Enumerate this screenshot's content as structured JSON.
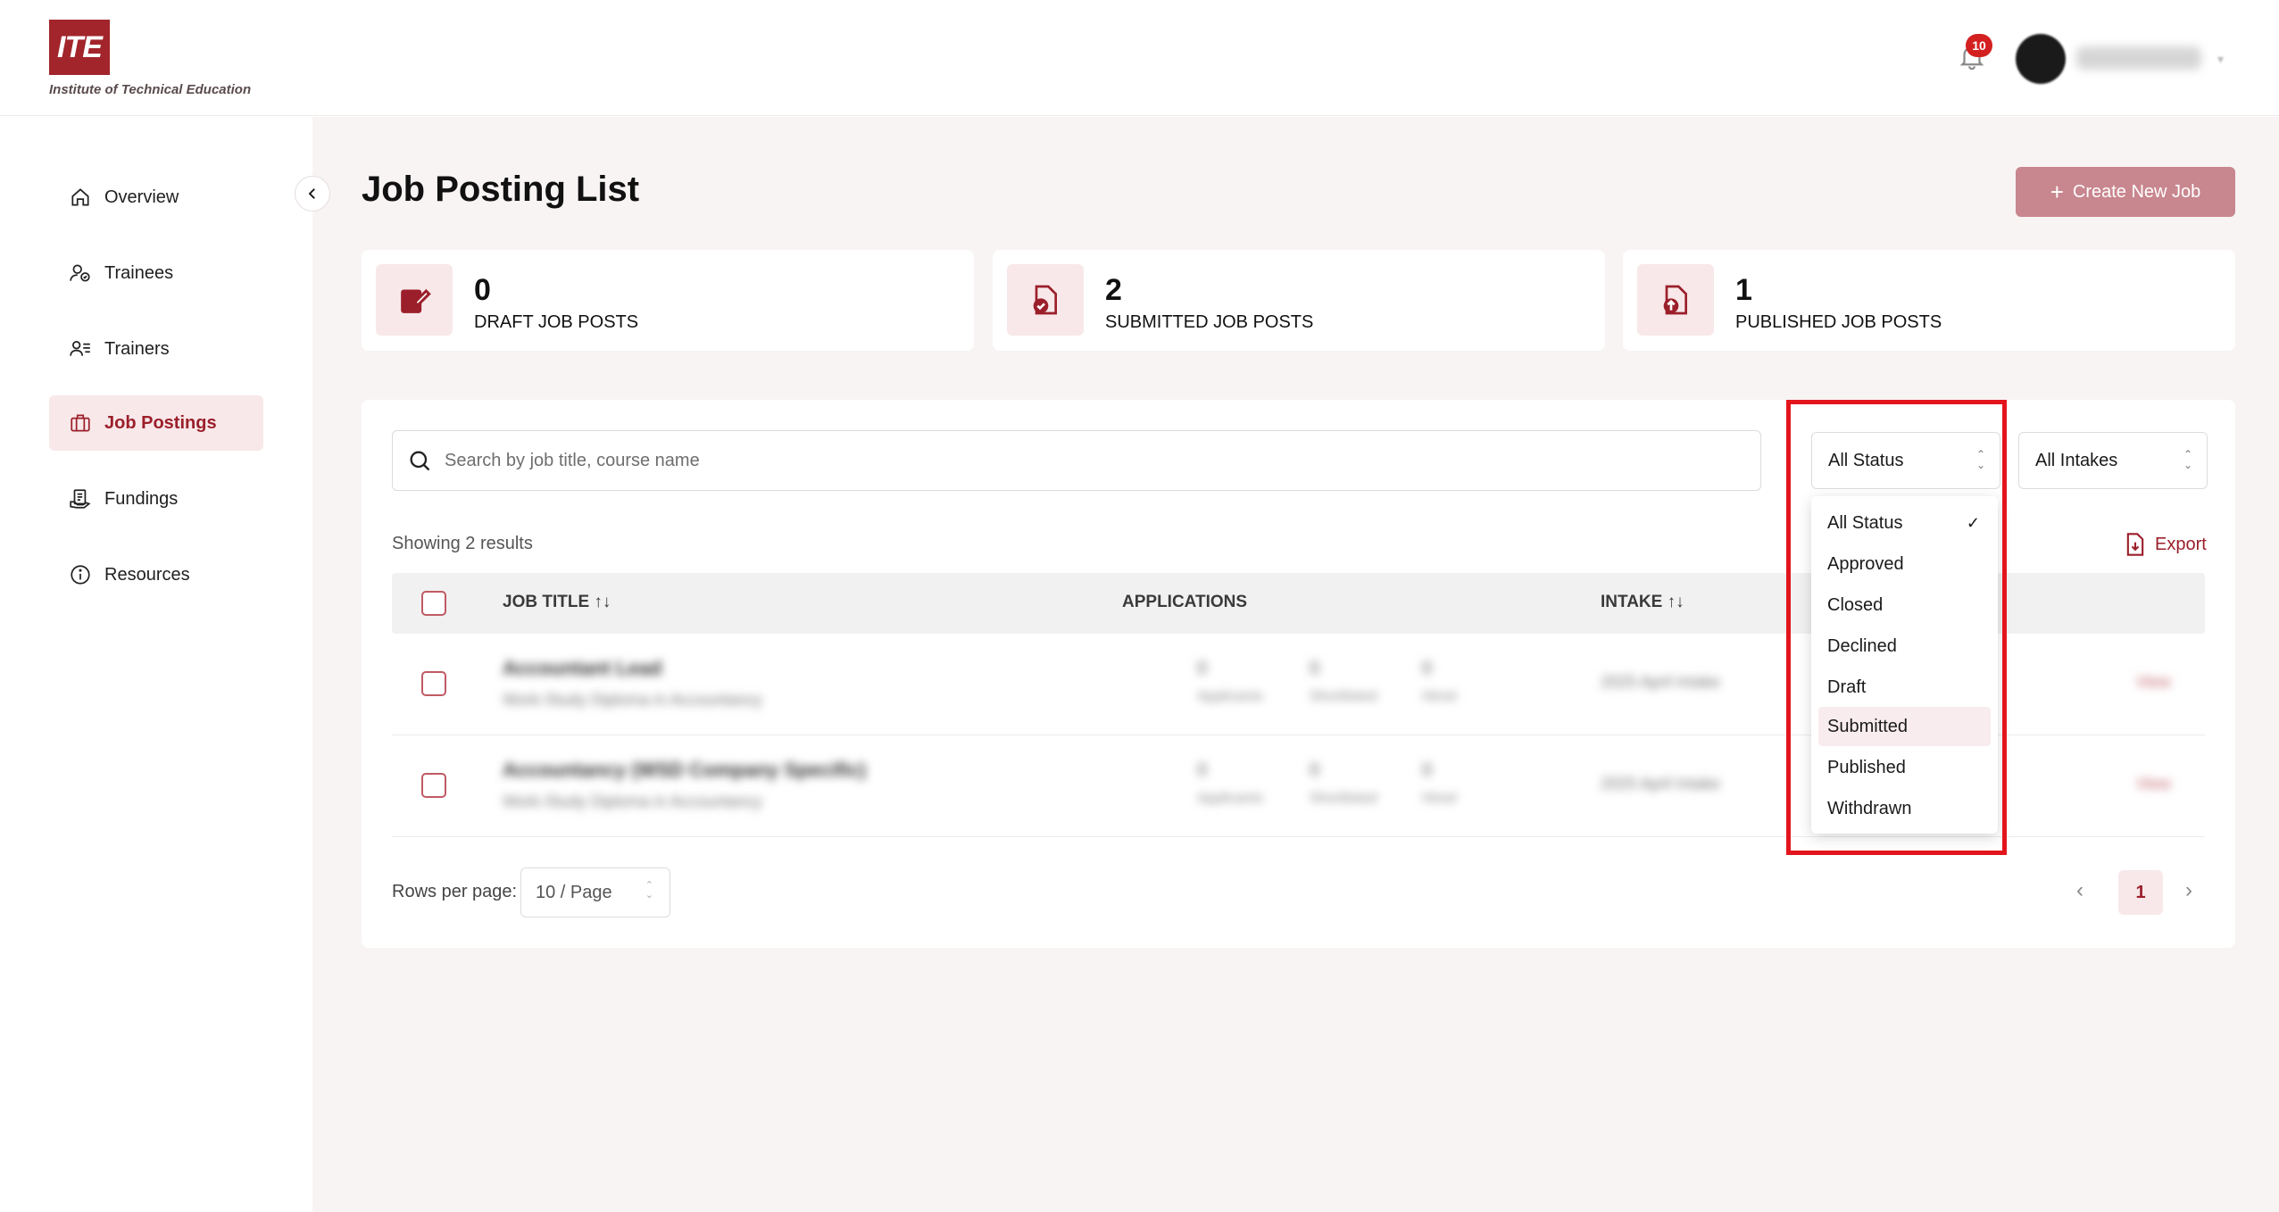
{
  "header": {
    "logo_mark": "ITE",
    "logo_text": "Institute of Technical Education",
    "notification_count": "10",
    "user_name": "User Name",
    "colors": {
      "brand": "#a1252b",
      "badge": "#d32020"
    }
  },
  "sidebar": {
    "items": [
      {
        "label": "Overview",
        "icon": "home-icon"
      },
      {
        "label": "Trainees",
        "icon": "trainees-icon"
      },
      {
        "label": "Trainers",
        "icon": "trainers-icon"
      },
      {
        "label": "Job Postings",
        "icon": "briefcase-icon",
        "active": true
      },
      {
        "label": "Fundings",
        "icon": "funding-icon"
      },
      {
        "label": "Resources",
        "icon": "info-icon"
      }
    ]
  },
  "main": {
    "title": "Job Posting List",
    "create_button": "Create New Job",
    "stats": [
      {
        "value": "0",
        "label": "DRAFT JOB POSTS",
        "icon": "edit-document-icon"
      },
      {
        "value": "2",
        "label": "SUBMITTED JOB POSTS",
        "icon": "submitted-document-icon"
      },
      {
        "value": "1",
        "label": "PUBLISHED JOB POSTS",
        "icon": "published-document-icon"
      }
    ],
    "search": {
      "placeholder": "Search by job title, course name",
      "value": ""
    },
    "status_filter": {
      "selected": "All Status"
    },
    "intake_filter": {
      "selected": "All Intakes"
    },
    "showing": "Showing 2 results",
    "export": "Export",
    "table": {
      "columns": [
        "JOB TITLE",
        "APPLICATIONS",
        "INTAKE"
      ],
      "sort_glyph": "↑↓",
      "rows": [
        {
          "title": "Accountant Lead",
          "course": "Work-Study Diploma in Accountancy",
          "applicants": "0",
          "shortlisted": "0",
          "hired": "0",
          "applicants_label": "Applicants",
          "shortlisted_label": "Shortlisted",
          "hired_label": "Hired",
          "intake": "2025 April Intake",
          "action": "View"
        },
        {
          "title": "Accountancy (WSD Company Specific)",
          "course": "Work-Study Diploma in Accountancy",
          "applicants": "0",
          "shortlisted": "0",
          "hired": "0",
          "applicants_label": "Applicants",
          "shortlisted_label": "Shortlisted",
          "hired_label": "Hired",
          "intake": "2025 April Intake",
          "action": "View"
        }
      ]
    },
    "pagination": {
      "rows_label": "Rows per page:",
      "rows_value": "10 / Page",
      "current_page": "1"
    }
  },
  "status_dropdown": {
    "options": [
      "All Status",
      "Approved",
      "Closed",
      "Declined",
      "Draft",
      "Submitted",
      "Published",
      "Withdrawn"
    ],
    "checked": "All Status",
    "hovered": "Submitted",
    "check_glyph": "✓"
  }
}
